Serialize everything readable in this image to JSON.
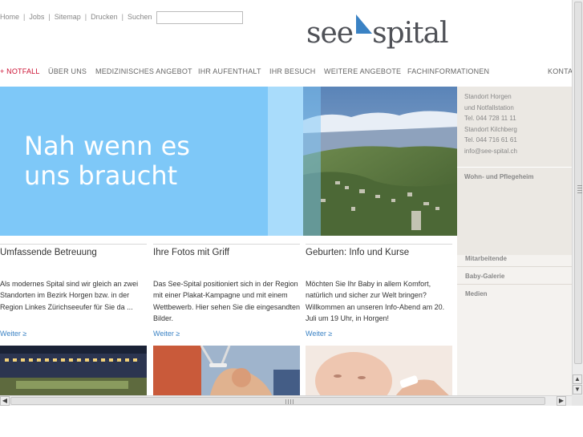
{
  "topnav": {
    "home": "Home",
    "jobs": "Jobs",
    "sitemap": "Sitemap",
    "drucken": "Drucken",
    "suchen": "Suchen",
    "separator": "|",
    "search_value": ""
  },
  "logo": {
    "part1": "see",
    "part2": "spital"
  },
  "mainnav": {
    "notfall": "+ NOTFALL",
    "ueber_uns": "ÜBER UNS",
    "medizin": "MEDIZINISCHES ANGEBOT",
    "aufenthalt": "IHR AUFENTHALT",
    "besuch": "IHR BESUCH",
    "weitere": "WEITERE ANGEBOTE",
    "fach": "FACHINFORMATIONEN",
    "kontakt": "KONTAKT"
  },
  "hero": {
    "headline": "Nah wenn es\nuns braucht"
  },
  "sidebar": {
    "contact": [
      "Standort Horgen",
      "und Notfallstation",
      "Tel. 044 728 11 11",
      "Standort Kilchberg",
      "Tel. 044 716 61 61",
      "info@see-spital.ch"
    ],
    "wohn": "Wohn- und Pflegeheim",
    "mitarbeitende": "Mitarbeitende",
    "baby_galerie": "Baby-Galerie",
    "medien": "Medien"
  },
  "teasers": [
    {
      "title": "Umfassende Betreuung",
      "text": "Als modernes Spital sind wir gleich an zwei Standorten im Bezirk Horgen bzw. in der Region Linkes Zürichseeufer für Sie da ...",
      "more": "Weiter ≥"
    },
    {
      "title": "Ihre Fotos mit Griff",
      "text": "Das See-Spital positioniert sich in der Region mit einer Plakat-Kampagne und mit einem Wettbewerb. Hier sehen Sie die eingesandten Bilder.",
      "more": "Weiter ≥"
    },
    {
      "title": "Geburten: Info und Kurse",
      "text": "Möchten Sie Ihr Baby in allem Komfort, natürlich und sicher zur Welt bringen? Willkommen an unseren Info-Abend am 20. Juli um 19 Uhr, in Horgen!",
      "more": "Weiter ≥"
    }
  ],
  "scroll": {
    "up": "▲",
    "down": "▼",
    "left": "◀",
    "right": "▶"
  },
  "colors": {
    "accent_blue": "#3a82c4",
    "hero_blue": "#7ec8f8",
    "notfall_red": "#cc1133",
    "sidebar_bg": "#ebe8e3"
  }
}
